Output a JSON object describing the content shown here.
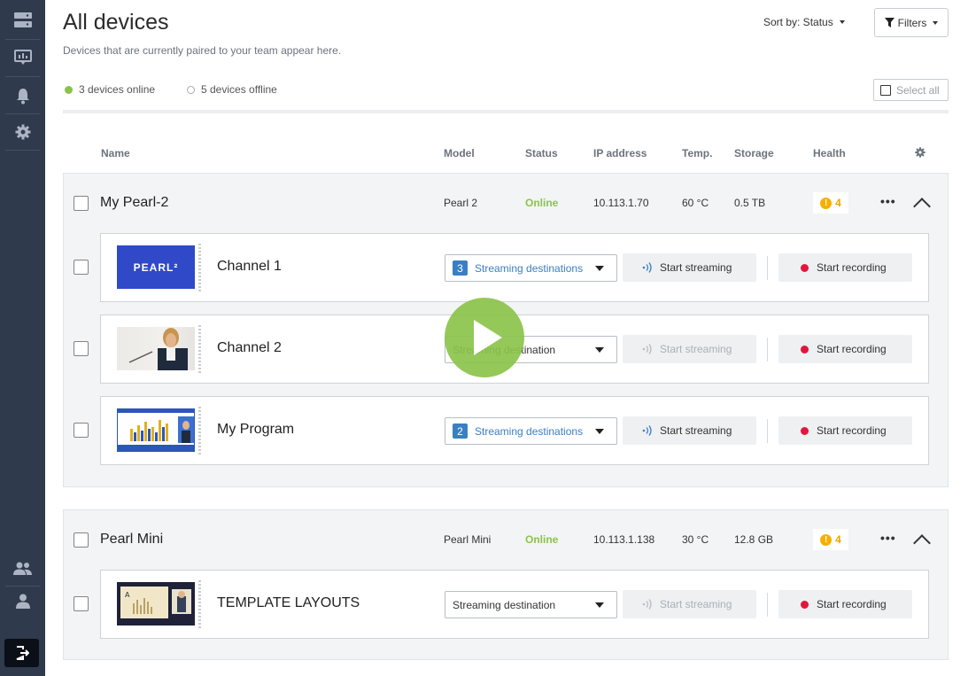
{
  "header": {
    "title": "All devices",
    "subtitle": "Devices that are currently paired to your team appear here.",
    "sort_label": "Sort by: Status",
    "filters_label": "Filters",
    "online_text": "3 devices online",
    "offline_text": "5 devices offline",
    "select_all_label": "Select all"
  },
  "columns": {
    "name": "Name",
    "model": "Model",
    "status": "Status",
    "ip": "IP address",
    "temp": "Temp.",
    "storage": "Storage",
    "health": "Health"
  },
  "devices": [
    {
      "name": "My Pearl-2",
      "model": "Pearl 2",
      "status": "Online",
      "ip": "10.113.1.70",
      "temp": "60 °C",
      "storage": "0.5 TB",
      "health_count": "4",
      "channels": [
        {
          "name": "Channel 1",
          "dest_count": "3",
          "dest_label": "Streaming destinations",
          "stream_label": "Start streaming",
          "record_label": "Start recording",
          "stream_enabled": true
        },
        {
          "name": "Channel 2",
          "dest_count": "",
          "dest_label": "Streaming destination",
          "stream_label": "Start streaming",
          "record_label": "Start recording",
          "stream_enabled": false
        },
        {
          "name": "My Program",
          "dest_count": "2",
          "dest_label": "Streaming destinations",
          "stream_label": "Start streaming",
          "record_label": "Start recording",
          "stream_enabled": true
        }
      ]
    },
    {
      "name": "Pearl Mini",
      "model": "Pearl Mini",
      "status": "Online",
      "ip": "10.113.1.138",
      "temp": "30 °C",
      "storage": "12.8 GB",
      "health_count": "4",
      "channels": [
        {
          "name": "TEMPLATE LAYOUTS",
          "dest_count": "",
          "dest_label": "Streaming destination",
          "stream_label": "Start streaming",
          "record_label": "Start recording",
          "stream_enabled": false
        }
      ]
    }
  ],
  "thumbnails": {
    "pearl_logo_text": "PEARL²"
  },
  "colors": {
    "sidebar": "#2f3a4c",
    "accent_blue": "#3a7fc4",
    "online_green": "#8bc34a",
    "warning": "#f6b000",
    "record_red": "#e2163d"
  },
  "icons": [
    "servers-icon",
    "display-icon",
    "bell-icon",
    "gear-icon",
    "users-icon",
    "user-icon",
    "logout-icon",
    "play-icon"
  ]
}
